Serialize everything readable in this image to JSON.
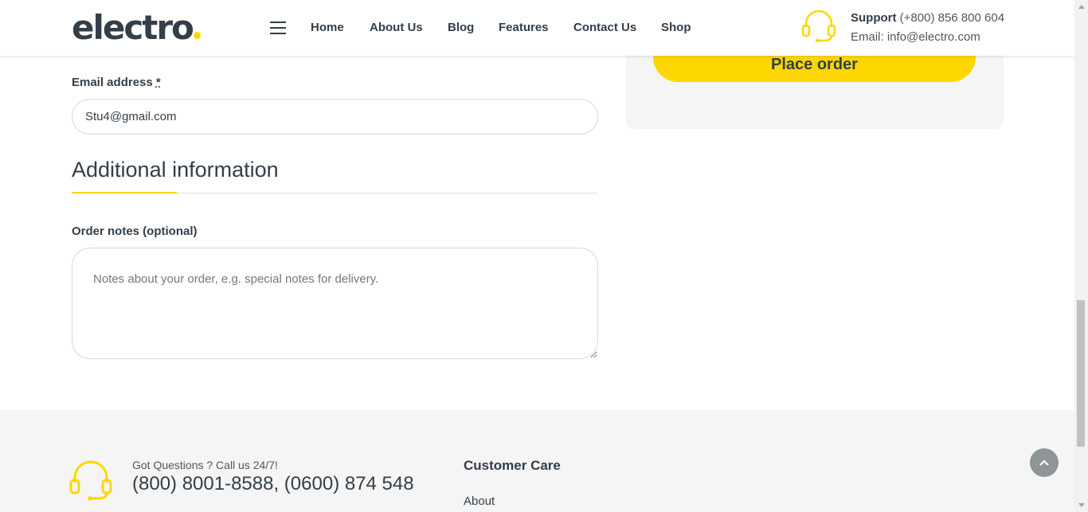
{
  "header": {
    "logo_text": "electro",
    "nav": [
      "Home",
      "About Us",
      "Blog",
      "Features",
      "Contact Us",
      "Shop"
    ],
    "support_label": "Support",
    "support_phone": "(+800) 856 800 604",
    "support_email": "Email: info@electro.com"
  },
  "summary": {
    "place_order_label": "Place order"
  },
  "form": {
    "email_label": "Email address",
    "required_mark": "*",
    "email_value": "Stu4@gmail.com",
    "additional_title": "Additional information",
    "notes_label": "Order notes (optional)",
    "notes_placeholder": "Notes about your order, e.g. special notes for delivery."
  },
  "footer": {
    "questions_text": "Got Questions ? Call us 24/7!",
    "phones": "(800) 8001-8588, (0600) 874 548",
    "customer_care_heading": "Customer Care",
    "links": [
      "About"
    ]
  },
  "colors": {
    "accent": "#fed700",
    "text": "#333e48",
    "footer_bg": "#f5f5f5"
  },
  "icons": [
    "menu-icon",
    "headset-icon",
    "chevron-up-icon"
  ]
}
